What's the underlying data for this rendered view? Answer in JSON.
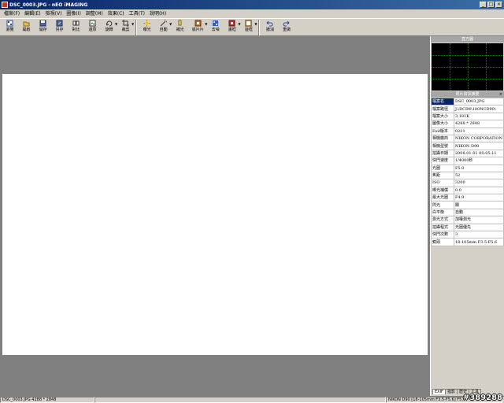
{
  "window": {
    "title": "DSC_0003.JPG - nEO iMAGING"
  },
  "menubar": [
    "檔案(F)",
    "編輯(E)",
    "檢視(V)",
    "圖像(I)",
    "調整(M)",
    "效果(C)",
    "工具(T)",
    "說明(H)"
  ],
  "toolbar": {
    "browse": "瀏覽",
    "open": "開啟",
    "save": "儲存",
    "saveas": "另存",
    "compare": "對比",
    "restore": "還原",
    "rotate": "旋轉",
    "crop": "裁剪",
    "exposure": "曝光",
    "auto": "自動",
    "fill_light": "補光",
    "film": "底片片",
    "denoise": "去噪",
    "frame": "畫框",
    "edge": "邊框",
    "undo": "撤消",
    "redo": "重做"
  },
  "panel": {
    "histogram_title": "直方圖",
    "info_title": "照片資訊摘要",
    "info": [
      {
        "k": "檔案名",
        "v": "DSC_0003.JPG"
      },
      {
        "k": "檔案路徑",
        "v": "J:\\DCIM\\100NCD90\\"
      },
      {
        "k": "檔案大小",
        "v": "3,181K"
      },
      {
        "k": "圖像大小",
        "v": "4288 * 2848"
      },
      {
        "k": "Exif版本",
        "v": "0221"
      },
      {
        "k": "相機廠商",
        "v": "NIKON CORPORATION"
      },
      {
        "k": "相機型號",
        "v": "NIKON D90"
      },
      {
        "k": "拍攝日期",
        "v": "2008.01.01 00:05:11"
      },
      {
        "k": "快門速度",
        "v": "1/4000秒"
      },
      {
        "k": "光圈",
        "v": "F5.0"
      },
      {
        "k": "焦距",
        "v": "52"
      },
      {
        "k": "ISO",
        "v": "3200"
      },
      {
        "k": "曝光補償",
        "v": "0.0"
      },
      {
        "k": "最大光圈",
        "v": "F4.9"
      },
      {
        "k": "閃光",
        "v": "關"
      },
      {
        "k": "白平衡",
        "v": "自動"
      },
      {
        "k": "測光方式",
        "v": "加權測光"
      },
      {
        "k": "拍攝程式",
        "v": "光圈優先"
      },
      {
        "k": "快門次數",
        "v": "3"
      },
      {
        "k": "鏡頭",
        "v": "18-105mm F3.5-F5.6"
      }
    ],
    "tabs": [
      "EXIF",
      "指影",
      "歷史",
      "工具"
    ]
  },
  "status": {
    "file": "DSC_0003.JPG  4288 * 2848",
    "camera": "NIKON D90 [18-105mm F3.5-F5.6] F5.0",
    "watermark": "#389288"
  }
}
